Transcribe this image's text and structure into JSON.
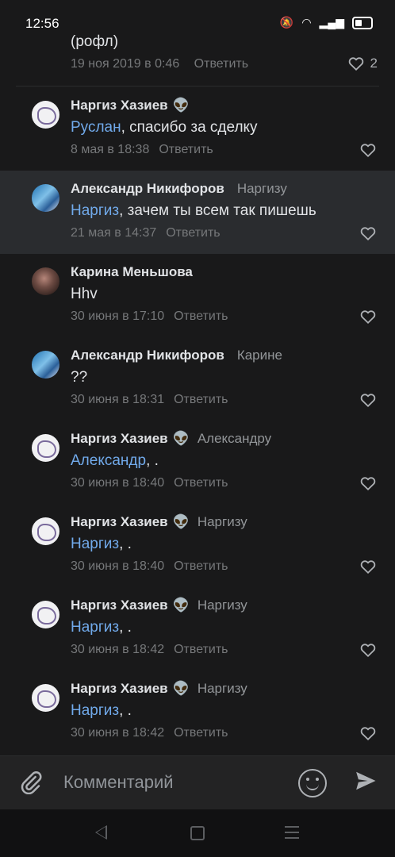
{
  "status_bar": {
    "time": "12:56"
  },
  "top_comment": {
    "text": "(рофл)",
    "date": "19 ноя 2019 в 0:46",
    "reply_label": "Ответить",
    "like_count": "2"
  },
  "comments": [
    {
      "author": "Наргиз Хазиев",
      "alien": "👽",
      "reply_to": "",
      "mention": "Руслан",
      "text": ", спасибо за сделку",
      "date": "8 мая в 18:38",
      "reply_label": "Ответить"
    },
    {
      "author": "Александр Никифоров",
      "alien": "",
      "reply_to": "Наргизу",
      "mention": "Наргиз",
      "text": ", зачем ты всем так пишешь",
      "date": "21 мая в 14:37",
      "reply_label": "Ответить"
    },
    {
      "author": "Карина Меньшова",
      "alien": "",
      "reply_to": "",
      "mention": "",
      "text": "Hhv",
      "date": "30 июня в 17:10",
      "reply_label": "Ответить"
    },
    {
      "author": "Александр Никифоров",
      "alien": "",
      "reply_to": "Карине",
      "mention": "",
      "text": "??",
      "date": "30 июня в 18:31",
      "reply_label": "Ответить"
    },
    {
      "author": "Наргиз Хазиев",
      "alien": "👽",
      "reply_to": "Александру",
      "mention": "Александр",
      "text": ", .",
      "date": "30 июня в 18:40",
      "reply_label": "Ответить"
    },
    {
      "author": "Наргиз Хазиев",
      "alien": "👽",
      "reply_to": "Наргизу",
      "mention": "Наргиз",
      "text": ", .",
      "date": "30 июня в 18:40",
      "reply_label": "Ответить"
    },
    {
      "author": "Наргиз Хазиев",
      "alien": "👽",
      "reply_to": "Наргизу",
      "mention": "Наргиз",
      "text": ", .",
      "date": "30 июня в 18:42",
      "reply_label": "Ответить"
    },
    {
      "author": "Наргиз Хазиев",
      "alien": "👽",
      "reply_to": "Наргизу",
      "mention": "Наргиз",
      "text": ", .",
      "date": "30 июня в 18:42",
      "reply_label": "Ответить"
    }
  ],
  "composer": {
    "placeholder": "Комментарий"
  },
  "colors": {
    "background": "#19191a",
    "mention": "#71aaeb",
    "highlight": "#2a2c2f"
  }
}
